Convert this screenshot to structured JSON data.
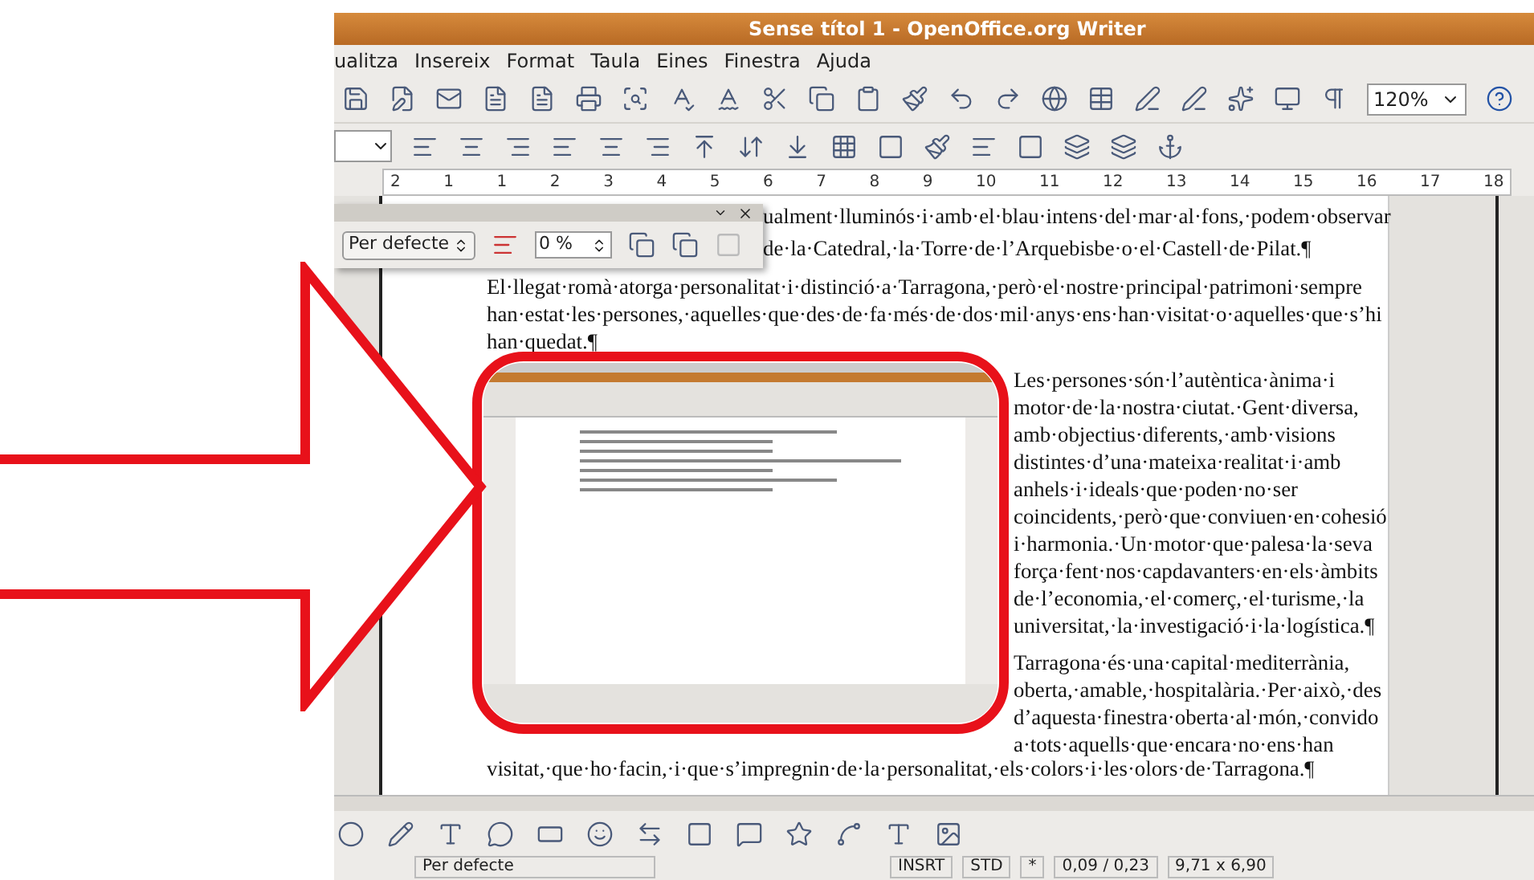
{
  "window": {
    "title": "Sense títol 1 - OpenOffice.org Writer"
  },
  "menu": [
    "ualitza",
    "Insereix",
    "Format",
    "Taula",
    "Eines",
    "Finestra",
    "Ajuda"
  ],
  "toolbar": {
    "zoom": "120%"
  },
  "ruler": [
    "2",
    "1",
    "1",
    "2",
    "3",
    "4",
    "5",
    "6",
    "7",
    "8",
    "9",
    "10",
    "11",
    "12",
    "13",
    "14",
    "15",
    "16",
    "17",
    "18"
  ],
  "floating_toolbar": {
    "style": "Per defecte",
    "percent": "0 %"
  },
  "document": {
    "top_lines": [
      "ualment·lluminós·i·amb·el·blau·intens·del·mar·al·fons,·podem·observar",
      "de·la·Catedral,·la·Torre·de·l’Arquebisbe·o·el·Castell·de·Pilat.¶"
    ],
    "paragraph": [
      "El·llegat·romà·atorga·personalitat·i·distinció·a·Tarragona,·però·el·nostre·principal·patrimoni·sempre",
      "han·estat·les·persones,·aquelles·que·des·de·fa·més·de·dos·mil·anys·ens·han·visitat·o·aquelles·que·s’hi",
      "han·quedat.¶"
    ],
    "wrap_paragraphs": [
      [
        "Les·persones·són·l’autèntica·ànima·i",
        "motor·de·la·nostra·ciutat.·Gent·diversa,",
        "amb·objectius·diferents,·amb·visions",
        "distintes·d’una·mateixa·realitat·i·amb",
        "anhels·i·ideals·que·poden·no·ser",
        "coincidents,·però·que·conviuen·en·cohesió",
        "i·harmonia.·Un·motor·que·palesa·la·seva",
        "força·fent·nos·capdavanters·en·els·àmbits",
        "de·l’economia,·el·comerç,·el·turisme,·la",
        "universitat,·la·investigació·i·la·logística.¶"
      ],
      [
        "Tarragona·és·una·capital·mediterrània,",
        "oberta,·amable,·hospitalària.·Per·això,·des",
        "d’aquesta·finestra·oberta·al·món,·convido",
        "a·tots·aquells·que·encara·no·ens·han"
      ]
    ],
    "full_line": "visitat,·que·ho·facin,·i·que·s’impregnin·de·la·personalitat,·els·colors·i·les·olors·de·Tarragona.¶"
  },
  "status_bar": [
    "Per defecte",
    "INSRT",
    "STD",
    "*",
    "0,09 / 0,23",
    "9,71 x 6,90"
  ]
}
